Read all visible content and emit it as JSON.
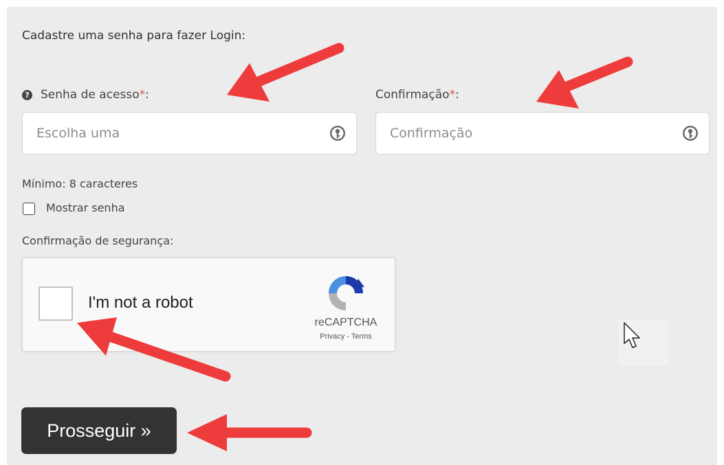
{
  "form": {
    "intro": "Cadastre uma senha para fazer Login:",
    "password_label": "Senha de acesso ",
    "password_required": "*",
    "password_label_suffix": ":",
    "password_placeholder": "Escolha uma",
    "confirm_label": "Confirmação",
    "confirm_required": "*",
    "confirm_label_suffix": ":",
    "confirm_placeholder": "Confirmação",
    "min_hint": "Mínimo: 8 caracteres",
    "show_password_label": "Mostrar senha",
    "security_label": "Confirmação de segurança:",
    "submit_label": "Prosseguir »"
  },
  "recaptcha": {
    "label": "I'm not a robot",
    "brand": "reCAPTCHA",
    "privacy": "Privacy",
    "separator": " - ",
    "terms": "Terms"
  },
  "icons": {
    "help": "?",
    "key": "key-icon",
    "cursor": "mouse-pointer-icon"
  },
  "colors": {
    "panel": "#ececec",
    "button": "#333333",
    "required": "#d9534f",
    "arrow": "#ee3b3b"
  }
}
